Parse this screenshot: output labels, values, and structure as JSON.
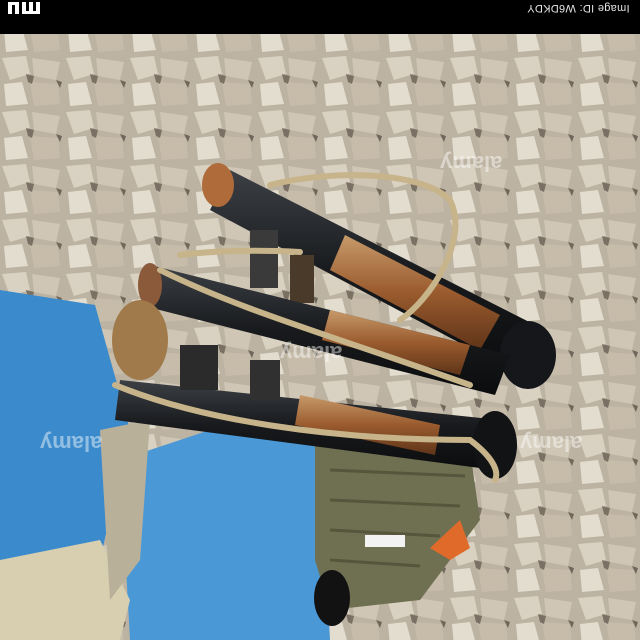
{
  "top_bar": {
    "brand": "alamy",
    "image_id": "Image ID: W6DKDY"
  },
  "photo": {
    "subject": "",
    "colors": {
      "rubble": "#cfc6b6",
      "rubble_shadow": "#6f675a",
      "blue_paint": "#3f8fcf",
      "launcher_tube": "#1d1f22",
      "wood_grip": "#8a4a22",
      "strap": "#c7b48a",
      "vest": "#6f7051"
    }
  },
  "watermarks": [
    "alamy",
    "alamy",
    "alamy",
    "alamy"
  ]
}
